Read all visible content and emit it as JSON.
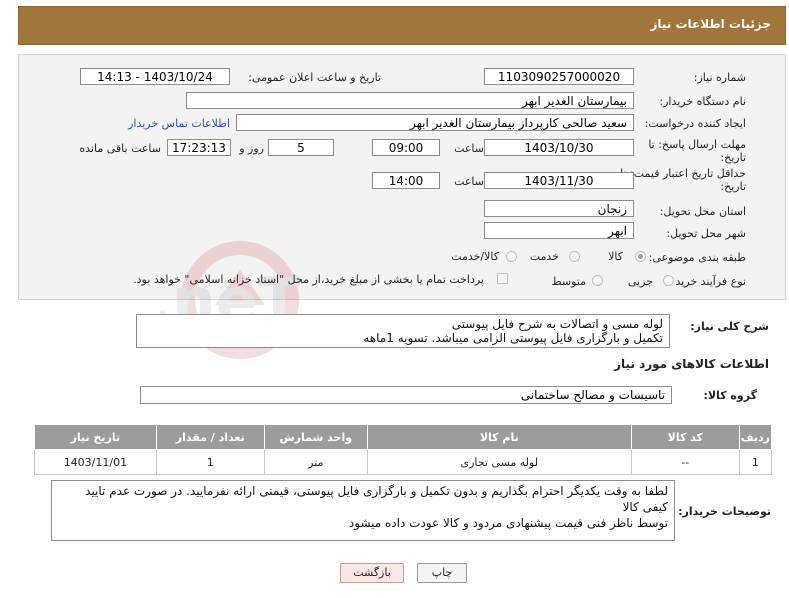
{
  "header": {
    "title": "جزئیات اطلاعات نیاز"
  },
  "form": {
    "need_number_label": "شماره نیاز:",
    "need_number": "1103090257000020",
    "announce_label": "تاریخ و ساعت اعلان عمومی:",
    "announce_value": "1403/10/24 - 14:13",
    "buyer_org_label": "نام دستگاه خریدار:",
    "buyer_org": "بیمارستان الغدیر ابهر",
    "requester_label": "ایجاد کننده درخواست:",
    "requester": "سعید صالحی کارپرداز بیمارستان الغدیر ابهر",
    "contact_link": "اطلاعات تماس خریدار",
    "deadline_label_1": "مهلت ارسال پاسخ: تا",
    "deadline_label_2": "تاریخ:",
    "deadline_date": "1403/10/30",
    "time_label": "ساعت",
    "deadline_time": "09:00",
    "days_value": "5",
    "days_label": "روز و",
    "remaining_time": "17:23:13",
    "remaining_label": "ساعت باقی مانده",
    "validity_label_1": "حداقل تاریخ اعتبار قیمت: تا",
    "validity_label_2": "تاریخ:",
    "validity_date": "1403/11/30",
    "validity_time": "14:00",
    "province_label": "استان محل تحویل:",
    "province": "زنجان",
    "city_label": "شهر محل تحویل:",
    "city": "ابهر",
    "category_label": "طبقه بندی موضوعی:",
    "category_options": [
      "کالا",
      "خدمت",
      "کالا/خدمت"
    ],
    "process_label": "نوع فرآیند خرید :",
    "process_options": [
      "جزیی",
      "متوسط"
    ],
    "payment_text": "پرداخت تمام یا بخشی از مبلغ خرید،از محل \"اسناد خزانه اسلامی\" خواهد بود."
  },
  "description": {
    "label": "شرح کلی نیاز:",
    "line1": "لوله مسی و اتصالات به شرح فایل پیوستی",
    "line2": "تکمیل و بارگزاری فایل پیوستی الزامی میباشد. تسویه 1ماهه"
  },
  "goods": {
    "section_title": "اطلاعات کالاهای مورد نیاز",
    "group_label": "گروه کالا:",
    "group_value": "تاسیسات و مصالح ساختمانی",
    "columns": [
      "ردیف",
      "کد کالا",
      "نام کالا",
      "واحد شمارش",
      "تعداد / مقدار",
      "تاریخ نیاز"
    ],
    "rows": [
      {
        "row": "1",
        "code": "--",
        "name": "لوله مسی تجاری",
        "unit": "متر",
        "qty": "1",
        "date": "1403/11/01"
      }
    ]
  },
  "buyer_notes": {
    "label": "توضیحات خریدار:",
    "line1": "لطفا به وقت یکدیگر احترام بگذاریم و بدون تکمیل و بارگزاری فایل پیوستی، قیمتی ارائه نفرمایید. در صورت عدم تایید کیفی کالا",
    "line2": "توسط ناظر فنی قیمت پیشنهادی مردود و کالا عودت داده میشود"
  },
  "buttons": {
    "print": "چاپ",
    "back": "بازگشت"
  },
  "watermark": {
    "text": "AriaTender.neT"
  },
  "colors": {
    "header_bg": "#a0763c",
    "table_header_bg": "#9c9c9c",
    "back_button_bg": "#fde6e6",
    "link": "#2a4eb1"
  }
}
